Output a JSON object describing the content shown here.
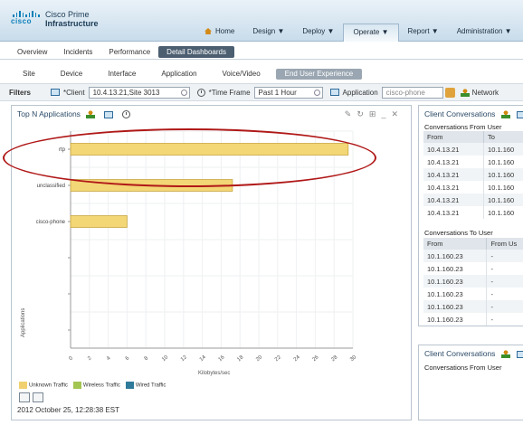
{
  "app": {
    "brand": "cisco",
    "product_line1": "Cisco Prime",
    "product_line2": "Infrastructure"
  },
  "topnav": [
    {
      "label": "Home",
      "arrow": ""
    },
    {
      "label": "Design",
      "arrow": "▼"
    },
    {
      "label": "Deploy",
      "arrow": "▼"
    },
    {
      "label": "Operate",
      "arrow": "▼"
    },
    {
      "label": "Report",
      "arrow": "▼"
    },
    {
      "label": "Administration",
      "arrow": "▼"
    }
  ],
  "tabs": [
    "Overview",
    "Incidents",
    "Performance",
    "Detail Dashboards"
  ],
  "subtabs": [
    "Site",
    "Device",
    "Interface",
    "Application",
    "Voice/Video",
    "End User Experience"
  ],
  "filters": {
    "label": "Filters",
    "client_label": "*Client",
    "client_value": "10.4.13.21,Site 3013",
    "time_label": "*Time Frame",
    "time_value": "Past 1 Hour",
    "app_label": "Application",
    "app_value": "cisco-phone",
    "network_label": "Network"
  },
  "dashlet": {
    "title": "Top N Applications",
    "ylabel": "Applications",
    "xlabel": "Kilobytes/sec",
    "legend": [
      {
        "label": "Unknown Traffic",
        "color": "#f0d070"
      },
      {
        "label": "Wireless Traffic",
        "color": "#a3c552"
      },
      {
        "label": "Wired Traffic",
        "color": "#2f7a9a"
      }
    ],
    "timestamp": "2012 October 25, 12:28:38 EST"
  },
  "chart_data": {
    "type": "bar",
    "orientation": "horizontal",
    "categories": [
      "rtp",
      "unclassified",
      "cisco-phone",
      "",
      "",
      ""
    ],
    "series": [
      {
        "name": "Unknown Traffic",
        "values": [
          29.5,
          17.2,
          6.0,
          null,
          null,
          null
        ]
      }
    ],
    "xlabel": "Kilobytes/sec",
    "ylabel": "Applications",
    "xlim": [
      0,
      30
    ],
    "xticks": [
      0,
      2,
      4,
      6,
      8,
      10,
      12,
      14,
      16,
      18,
      20,
      22,
      24,
      26,
      28,
      30
    ],
    "grid": true,
    "legend_position": "bottom-left"
  },
  "right_panel": {
    "title": "Client Conversations",
    "from_user_title": "Conversations From User",
    "from_user_cols": [
      "From",
      "To"
    ],
    "from_user_rows": [
      [
        "10.4.13.21",
        "10.1.160"
      ],
      [
        "10.4.13.21",
        "10.1.160"
      ],
      [
        "10.4.13.21",
        "10.1.160"
      ],
      [
        "10.4.13.21",
        "10.1.160"
      ],
      [
        "10.4.13.21",
        "10.1.160"
      ],
      [
        "10.4.13.21",
        "10.1.160"
      ]
    ],
    "to_user_title": "Conversations To User",
    "to_user_cols": [
      "From",
      "From Us"
    ],
    "to_user_rows": [
      [
        "10.1.160.23",
        "-"
      ],
      [
        "10.1.160.23",
        "-"
      ],
      [
        "10.1.160.23",
        "-"
      ],
      [
        "10.1.160.23",
        "-"
      ],
      [
        "10.1.160.23",
        "-"
      ],
      [
        "10.1.160.23",
        "-"
      ]
    ]
  },
  "right_panel2": {
    "title": "Client Conversations",
    "subtitle": "Conversations From User"
  }
}
